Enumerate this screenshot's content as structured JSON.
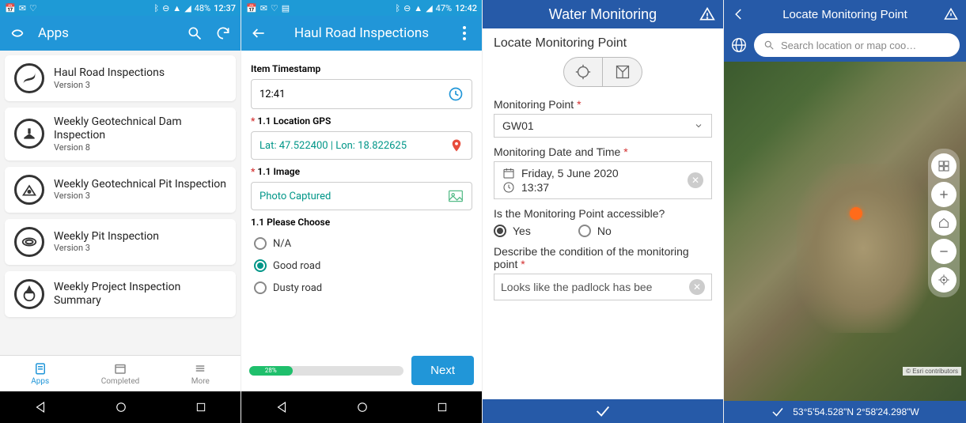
{
  "screen1": {
    "statusbar_time": "12:37",
    "battery": "48%",
    "title": "Apps",
    "apps": [
      {
        "title": "Haul Road Inspections",
        "version": "Version 3"
      },
      {
        "title": "Weekly Geotechnical Dam Inspection",
        "version": "Version 8"
      },
      {
        "title": "Weekly Geotechnical Pit Inspection",
        "version": "Version 3"
      },
      {
        "title": "Weekly Pit Inspection",
        "version": "Version 3"
      },
      {
        "title": "Weekly Project Inspection Summary",
        "version": ""
      }
    ],
    "tabs": {
      "apps": "Apps",
      "completed": "Completed",
      "more": "More"
    }
  },
  "screen2": {
    "statusbar_time": "12:42",
    "battery": "47%",
    "title": "Haul Road Inspections",
    "labels": {
      "timestamp": "Item Timestamp",
      "gps": "1.1 Location GPS",
      "image": "1.1 Image",
      "choose": "1.1 Please Choose"
    },
    "values": {
      "timestamp": "12:41",
      "gps": "Lat: 47.522400 | Lon: 18.822625",
      "image": "Photo Captured"
    },
    "options": {
      "na": "N/A",
      "good": "Good road",
      "dusty": "Dusty road"
    },
    "selected": "good",
    "progress": {
      "percent": 28,
      "label": "28%"
    },
    "next": "Next"
  },
  "screen3": {
    "title": "Water Monitoring",
    "heading": "Locate Monitoring Point",
    "labels": {
      "point": "Monitoring Point",
      "datetime": "Monitoring Date and Time",
      "accessible": "Is the Monitoring Point accessible?",
      "describe": "Describe the condition of the monitoring point"
    },
    "values": {
      "point": "GW01",
      "date": "Friday, 5 June 2020",
      "time": "13:37",
      "describe": "Looks like the padlock has bee"
    },
    "yes": "Yes",
    "no": "No",
    "accessible_selected": "yes"
  },
  "screen4": {
    "title": "Locate Monitoring Point",
    "search_placeholder": "Search location or map coo…",
    "attrib": "© Esri contributors",
    "coords": "53°5'54.528\"N 2°58'24.298\"W"
  }
}
